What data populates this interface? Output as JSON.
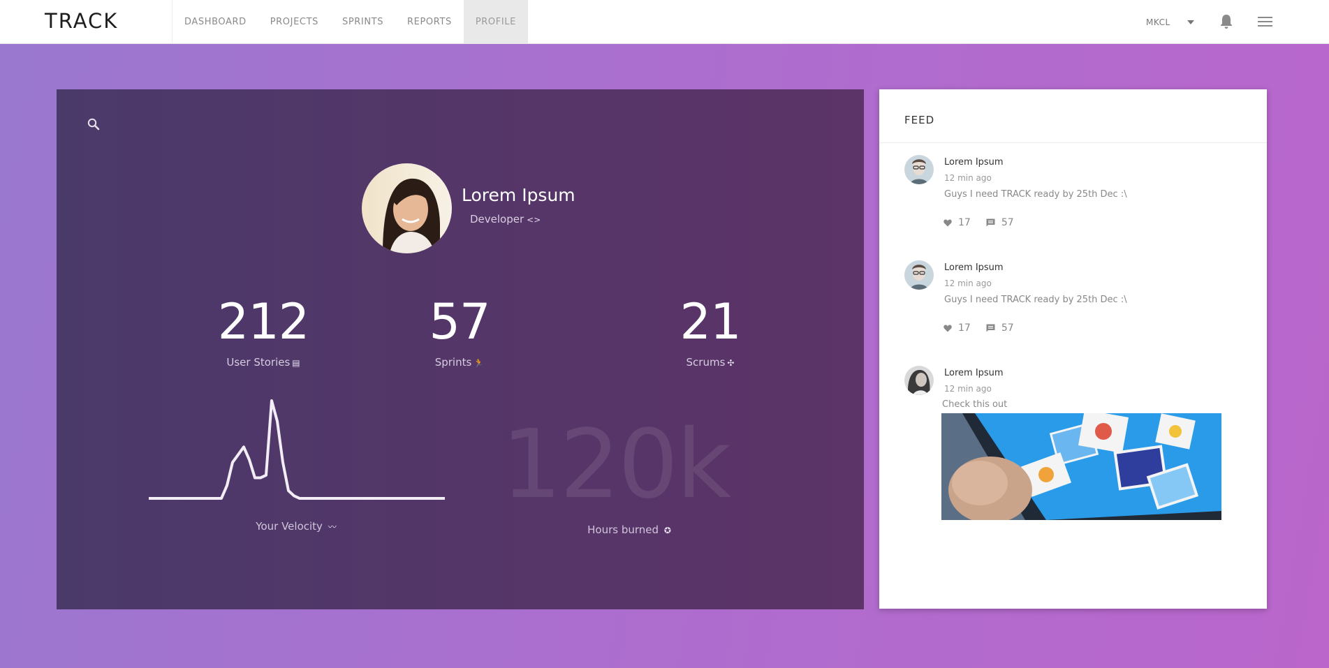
{
  "app": {
    "logo": "TRACK"
  },
  "nav": {
    "items": [
      {
        "label": "DASHBOARD"
      },
      {
        "label": "PROJECTS"
      },
      {
        "label": "SPRINTS"
      },
      {
        "label": "REPORTS"
      },
      {
        "label": "PROFILE",
        "active": true
      }
    ],
    "user": "MKCL",
    "icons": {
      "bell": "bell-icon",
      "menu": "hamburger-icon",
      "dropdown": "chevron-down-icon"
    }
  },
  "profile": {
    "name": "Lorem Ipsum",
    "role": "Developer",
    "role_icon": "<>",
    "stats": [
      {
        "value": "212",
        "label": "User Stories",
        "icon": "▤"
      },
      {
        "value": "57",
        "label": "Sprints",
        "icon": "🏃"
      },
      {
        "value": "21",
        "label": "Scrums",
        "icon": "✣"
      }
    ],
    "velocity": {
      "label": "Your Velocity",
      "icon": "〰",
      "values": [
        0,
        0,
        0,
        0,
        0,
        0,
        0,
        0,
        0,
        0,
        0,
        0,
        0,
        0,
        5,
        14,
        17,
        20,
        15,
        8,
        8,
        9,
        38,
        30,
        14,
        3,
        1,
        0,
        0,
        0,
        0,
        0,
        0,
        0,
        0,
        0,
        0,
        0,
        0,
        0,
        0,
        0,
        0,
        0,
        0,
        0,
        0,
        0,
        0,
        0,
        0,
        0,
        0,
        0
      ]
    },
    "hours": {
      "value": "120k",
      "label": "Hours burned",
      "icon": "✪"
    }
  },
  "feed": {
    "title": "FEED",
    "posts": [
      {
        "author": "Lorem Ipsum",
        "time": "12 min ago",
        "text": "Guys I need TRACK ready by 25th Dec :\\",
        "likes": "17",
        "comments": "57"
      },
      {
        "author": "Lorem Ipsum",
        "time": "12 min ago",
        "text": "Guys I need TRACK ready by 25th Dec :\\",
        "likes": "17",
        "comments": "57"
      },
      {
        "author": "Lorem Ipsum",
        "time": "12 min ago",
        "text": "Check this out"
      }
    ]
  },
  "colors": {
    "background_start": "#9a78cf",
    "background_end": "#ba66cb",
    "panel": "#4f376a",
    "feed_bg": "#ffffff"
  }
}
